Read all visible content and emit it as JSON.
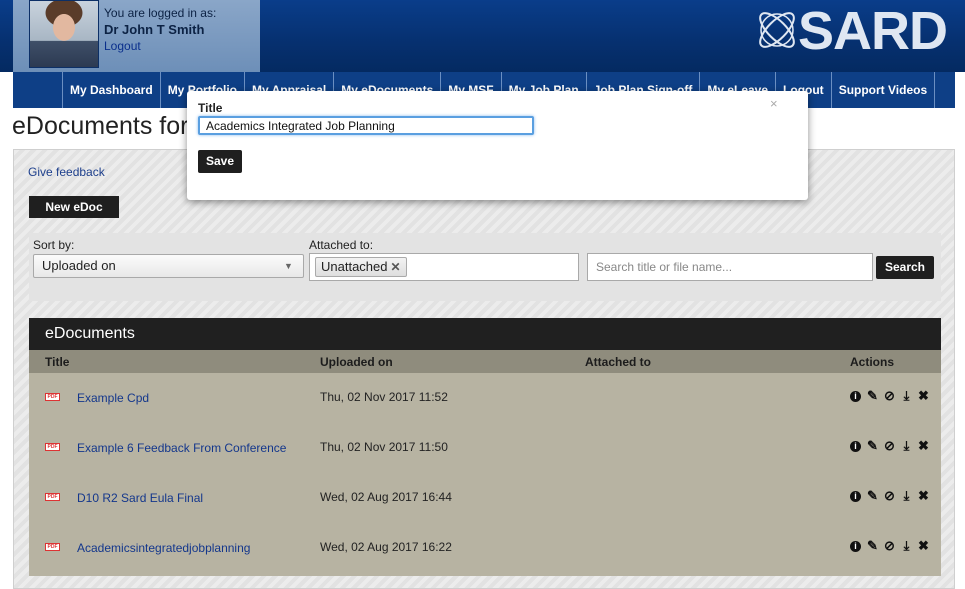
{
  "header": {
    "logged_in_label": "You are logged in as:",
    "user_name": "Dr John T Smith",
    "logout_label": "Logout",
    "logo_text": "SARD",
    "brand_color": "#06306f"
  },
  "nav": {
    "items": [
      {
        "label": "My Dashboard"
      },
      {
        "label": "My Portfolio"
      },
      {
        "label": "My Appraisal"
      },
      {
        "label": "My eDocuments"
      },
      {
        "label": "My MSF"
      },
      {
        "label": "My Job Plan"
      },
      {
        "label": "Job Plan Sign-off"
      },
      {
        "label": "My eLeave"
      },
      {
        "label": "Logout"
      },
      {
        "label": "Support Videos"
      }
    ]
  },
  "page": {
    "title": "eDocuments for",
    "give_feedback": "Give feedback",
    "new_edoc": "New eDoc"
  },
  "filters": {
    "sort_label": "Sort by:",
    "sort_value": "Uploaded on",
    "attached_label": "Attached to:",
    "attached_tag": "Unattached",
    "search_placeholder": "Search title or file name...",
    "search_button": "Search"
  },
  "table": {
    "heading": "eDocuments",
    "columns": {
      "title": "Title",
      "uploaded": "Uploaded on",
      "attached": "Attached to",
      "actions": "Actions"
    },
    "rows": [
      {
        "title": "Example Cpd",
        "uploaded": "Thu, 02 Nov 2017 11:52",
        "attached": "",
        "file_icon": "PDF"
      },
      {
        "title": "Example 6 Feedback From Conference",
        "uploaded": "Thu, 02 Nov 2017 11:50",
        "attached": "",
        "file_icon": "PDF"
      },
      {
        "title": "D10 R2 Sard Eula Final",
        "uploaded": "Wed, 02 Aug 2017 16:44",
        "attached": "",
        "file_icon": "PDF"
      },
      {
        "title": "Academicsintegratedjobplanning",
        "uploaded": "Wed, 02 Aug 2017 16:22",
        "attached": "",
        "file_icon": "PDF"
      }
    ]
  },
  "modal": {
    "label": "Title",
    "input_value": "Academics Integrated Job Planning",
    "save_label": "Save",
    "close_symbol": "×"
  }
}
